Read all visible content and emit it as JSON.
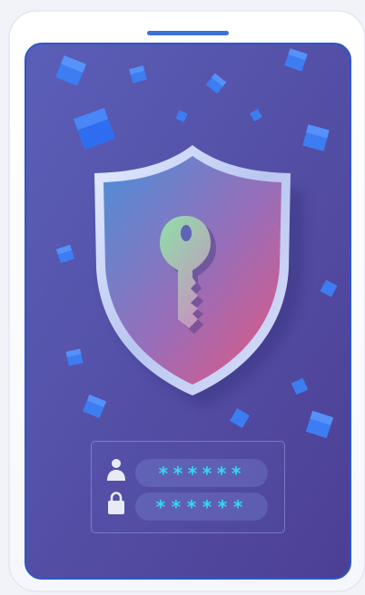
{
  "illustration": {
    "subject": "shield-with-key",
    "colors": {
      "page_background": "#f2f3f8",
      "phone_frame": "#ffffff",
      "phone_border": "#2d57c9",
      "screen_top": "#5b5fb8",
      "screen_bottom": "#4c3f93",
      "speaker": "#3a72d8",
      "shield_gradient_start": "#4d8fd8",
      "shield_gradient_end": "#e4577e",
      "shield_rim": "#c8d4f5",
      "key_gradient_start": "#8ee0a8",
      "key_gradient_end": "#c596c0",
      "cube": "#3d7df2",
      "password_text": "#35d6f5",
      "field_icon": "#e8eaf6"
    }
  },
  "login": {
    "username_mask": "******",
    "password_mask": "******"
  }
}
